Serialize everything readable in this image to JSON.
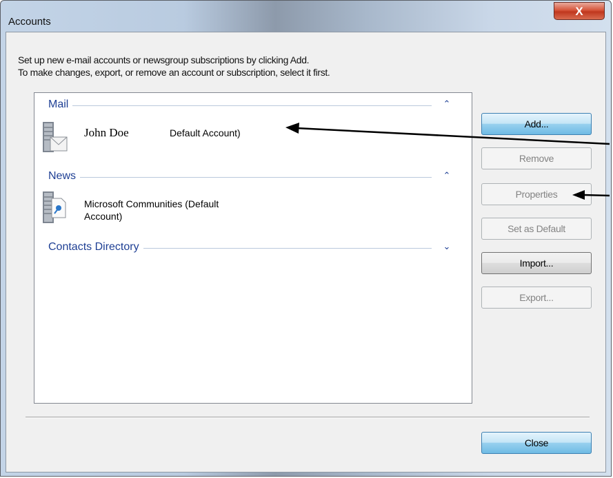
{
  "window": {
    "title": "Accounts",
    "close_glyph": "X"
  },
  "description": {
    "line1": "Set up new e-mail accounts or newsgroup subscriptions by clicking Add.",
    "line2": "To make changes, export, or remove an account or subscription, select it first."
  },
  "groups": [
    {
      "label": "Mail",
      "chevron": "⌃",
      "expanded": true
    },
    {
      "label": "News",
      "chevron": "⌃",
      "expanded": true
    },
    {
      "label": "Contacts Directory",
      "chevron": "⌄",
      "expanded": false
    }
  ],
  "accounts": {
    "mail": {
      "name": "John Doe",
      "status": "Default Account)",
      "icon": "mail-server-icon"
    },
    "news": {
      "line1": "Microsoft Communities (Default",
      "line2": "Account)",
      "icon": "news-server-icon"
    }
  },
  "buttons": {
    "add": "Add...",
    "remove": "Remove",
    "properties": "Properties",
    "set_default": "Set as Default",
    "import": "Import...",
    "export": "Export...",
    "close": "Close"
  },
  "colors": {
    "group_label": "#1e3f94",
    "close_button": "#c0371e",
    "annotation_arrow": "#000000"
  }
}
